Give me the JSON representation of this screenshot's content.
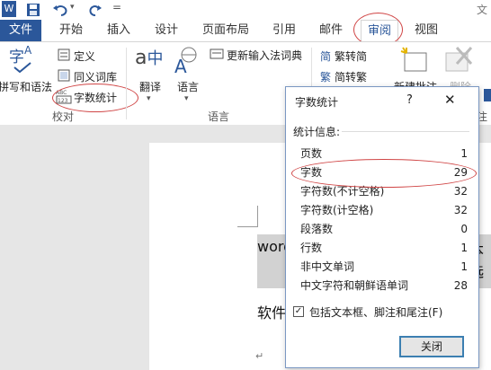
{
  "quick_access": {
    "word_logo": "W",
    "save_icon": "save-icon",
    "undo_icon": "undo-icon",
    "redo_icon": "redo-icon",
    "customize": "="
  },
  "window_title_partial": "文",
  "tabs": [
    "文件",
    "开始",
    "插入",
    "设计",
    "页面布局",
    "引用",
    "邮件",
    "审阅",
    "视图"
  ],
  "active_tab": "审阅",
  "ribbon": {
    "proofing": {
      "spelling": "拼写和语法",
      "define": "定义",
      "thesaurus": "同义词库",
      "word_count": "字数统计",
      "label": "校对"
    },
    "language": {
      "translate": "翻译",
      "language": "语言",
      "ime_dictionary": "更新输入法词典",
      "label": "语言"
    },
    "chinese": {
      "to_traditional": "繁转简",
      "to_simplified": "简转繁"
    },
    "comments": {
      "new_comment": "新建批注",
      "delete": "删除",
      "label_partial": "注"
    }
  },
  "document": {
    "line1": "word",
    "line1_right": "本选",
    "line2": "软件",
    "para_mark": "↵"
  },
  "dialog": {
    "title": "字数统计",
    "help": "?",
    "close": "✕",
    "section": "统计信息:",
    "stats": [
      {
        "label": "页数",
        "value": "1"
      },
      {
        "label": "字数",
        "value": "29"
      },
      {
        "label": "字符数(不计空格)",
        "value": "32"
      },
      {
        "label": "字符数(计空格)",
        "value": "32"
      },
      {
        "label": "段落数",
        "value": "0"
      },
      {
        "label": "行数",
        "value": "1"
      },
      {
        "label": "非中文单词",
        "value": "1"
      },
      {
        "label": "中文字符和朝鲜语单词",
        "value": "28"
      }
    ],
    "checkbox_label": "包括文本框、脚注和尾注(F)",
    "checkbox_checked": true,
    "close_button": "关闭"
  },
  "colors": {
    "accent": "#2b579a",
    "highlight_ring": "#d04545"
  }
}
